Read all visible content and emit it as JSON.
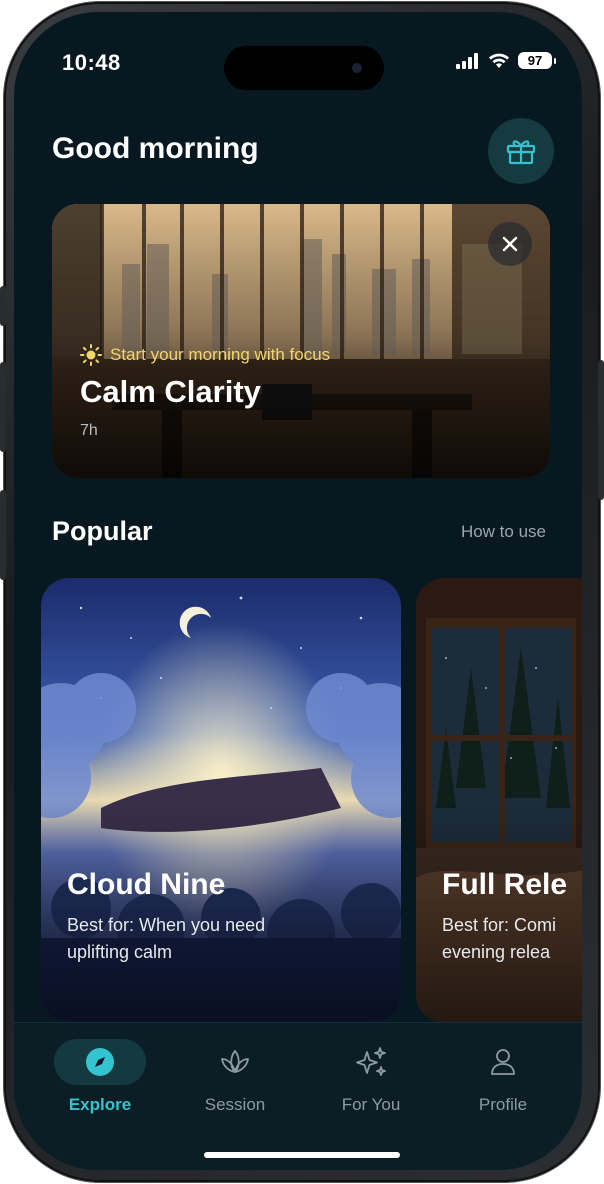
{
  "status_bar": {
    "time": "10:48",
    "battery": "97",
    "icons": [
      "signal-icon",
      "wifi-icon",
      "battery-icon"
    ]
  },
  "header": {
    "greeting": "Good morning",
    "gift_icon": "gift-icon"
  },
  "hero": {
    "tag": "Start your morning with focus",
    "tag_icon": "sun-icon",
    "title": "Calm Clarity",
    "duration": "7h",
    "close_icon": "close-icon"
  },
  "popular": {
    "title": "Popular",
    "link_label": "How to use",
    "cards": [
      {
        "title": "Cloud Nine",
        "desc_line1": "Best for: When you need",
        "desc_line2": "uplifting calm"
      },
      {
        "title": "Full Rele",
        "desc_line1": "Best for: Comi",
        "desc_line2": "evening relea"
      }
    ]
  },
  "tabs": [
    {
      "label": "Explore",
      "icon": "compass-icon",
      "active": true
    },
    {
      "label": "Session",
      "icon": "lotus-icon",
      "active": false
    },
    {
      "label": "For You",
      "icon": "sparkles-icon",
      "active": false
    },
    {
      "label": "Profile",
      "icon": "person-icon",
      "active": false
    }
  ],
  "colors": {
    "background": "#071820",
    "accent": "#33c4d0",
    "tag": "#f3d66b",
    "tab_bar": "#0b1e26"
  }
}
